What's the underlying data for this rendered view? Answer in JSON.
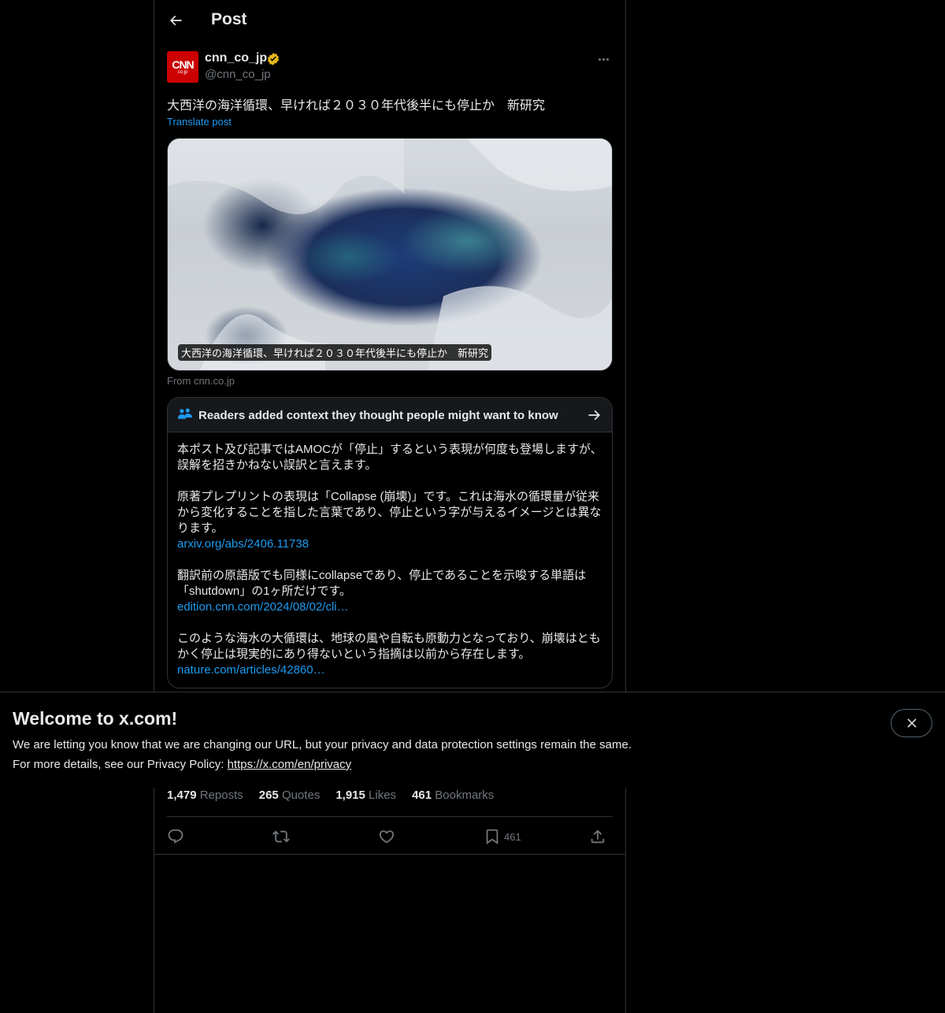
{
  "header": {
    "title": "Post",
    "back_icon": "arrow-left-icon"
  },
  "author": {
    "name": "cnn_co_jp",
    "handle": "@cnn_co_jp",
    "avatar_logo": "CNN",
    "avatar_sub": "co.jp",
    "verified_color": "#e2b719"
  },
  "post": {
    "text": "大西洋の海洋循環、早ければ２０３０年代後半にも停止か　新研究",
    "translate_label": "Translate post",
    "media_caption": "大西洋の海洋循環、早ければ２０３０年代後半にも停止か　新研究",
    "media_source": "From cnn.co.jp"
  },
  "notes": {
    "title": "Readers added context they thought people might want to know",
    "paragraphs": [
      {
        "text": "本ポスト及び記事ではAMOCが「停止」するという表現が何度も登場しますが、誤解を招きかねない誤訳と言えます。",
        "link": ""
      },
      {
        "text": "原著プレプリントの表現は「Collapse (崩壊)」です。これは海水の循環量が従来から変化することを指した言葉であり、停止という字が与えるイメージとは異なります。",
        "link": "arxiv.org/abs/2406.11738"
      },
      {
        "text": "翻訳前の原語版でも同様にcollapseであり、停止であることを示唆する単語は「shutdown」の1ヶ所だけです。",
        "link": "edition.cnn.com/2024/08/02/cli…"
      },
      {
        "text": "このような海水の大循環は、地球の風や自転も原動力となっており、崩壊はともかく停止は現実的にあり得ないという指摘は以前から存在します。",
        "link": "nature.com/articles/42860…"
      }
    ]
  },
  "banner": {
    "title": "Welcome to x.com!",
    "line1": "We are letting you know that we are changing our URL, but your privacy and data protection settings remain the same.",
    "line2_prefix": "For more details, see our Privacy Policy: ",
    "line2_link": "https://x.com/en/privacy"
  },
  "stats": {
    "reposts_count": "1,479",
    "reposts_label": "Reposts",
    "quotes_count": "265",
    "quotes_label": "Quotes",
    "likes_count": "1,915",
    "likes_label": "Likes",
    "bookmarks_count": "461",
    "bookmarks_label": "Bookmarks"
  },
  "actions": {
    "bookmark_count": "461"
  },
  "colors": {
    "accent": "#1d9bf0",
    "background": "#000000",
    "text": "#e7e9ea",
    "muted": "#71767b",
    "border": "#2f3336",
    "brand_red": "#cc0000"
  }
}
